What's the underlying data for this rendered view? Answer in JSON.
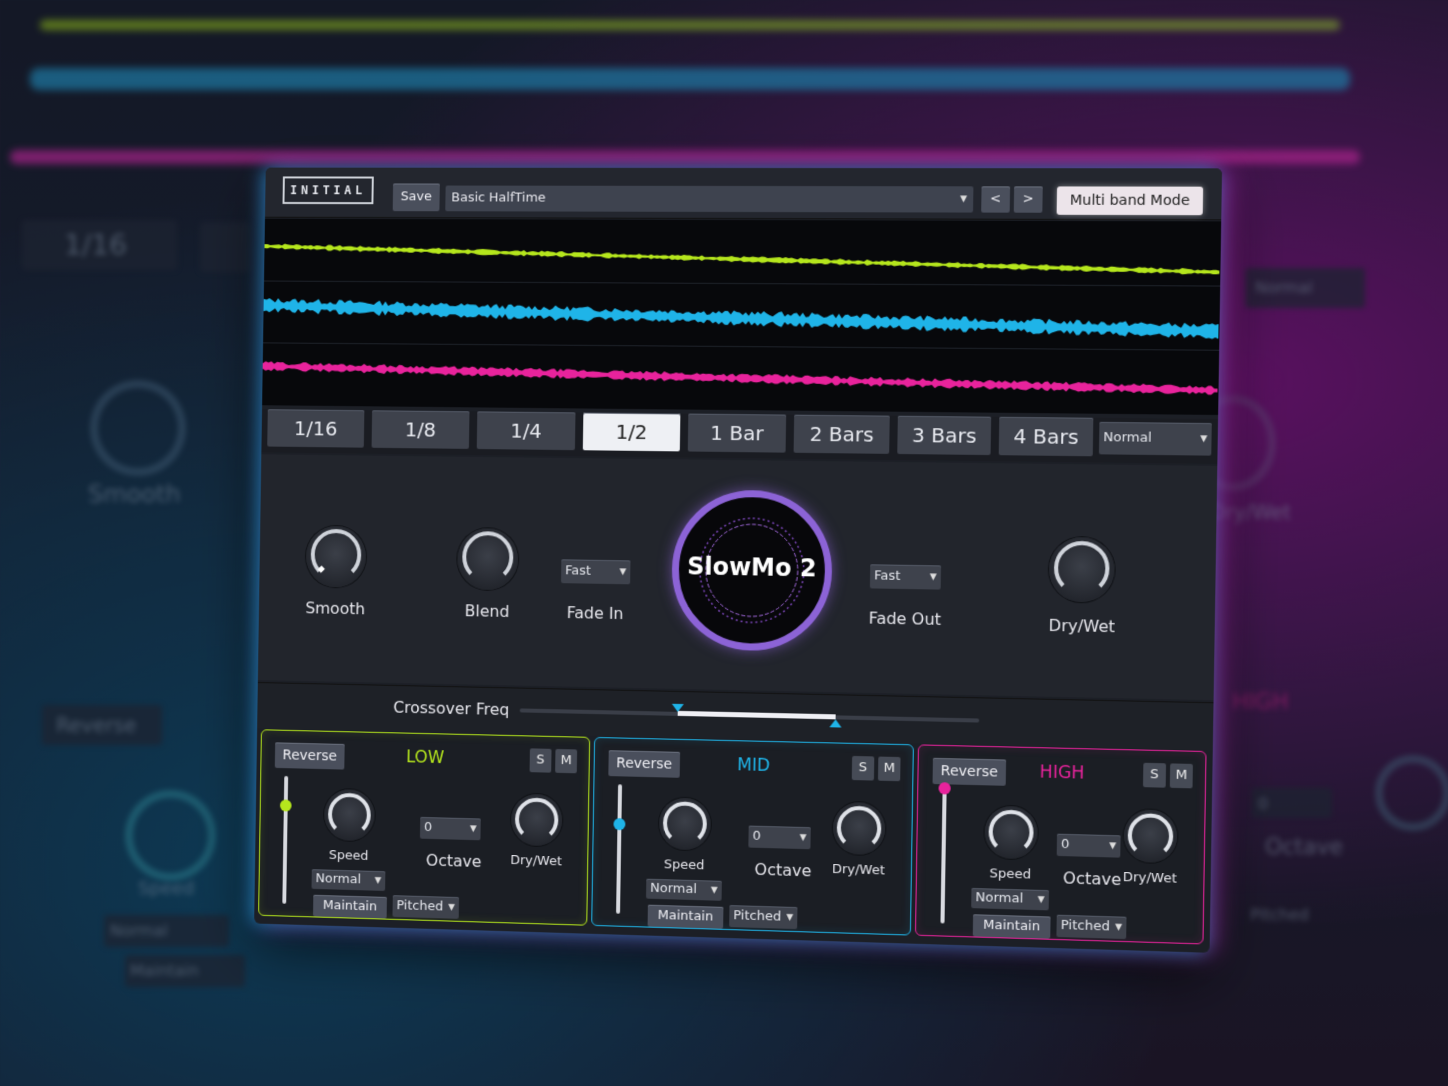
{
  "brand": {
    "logo_text": "INITIAL"
  },
  "toolbar": {
    "save_label": "Save",
    "preset_name": "Basic HalfTime",
    "prev_label": "<",
    "next_label": ">",
    "mode_button_label": "Multi band Mode"
  },
  "divisions": {
    "items": [
      "1/16",
      "1/8",
      "1/4",
      "1/2",
      "1 Bar",
      "2 Bars",
      "3 Bars",
      "4 Bars"
    ],
    "selected": "1/2",
    "mode_select_value": "Normal"
  },
  "controls": {
    "smooth_label": "Smooth",
    "blend_label": "Blend",
    "fade_in_label": "Fade In",
    "fade_in_value": "Fast",
    "fade_out_label": "Fade Out",
    "fade_out_value": "Fast",
    "dry_wet_label": "Dry/Wet",
    "product_name": "SlowMo 2"
  },
  "crossover": {
    "label": "Crossover Freq"
  },
  "bands": {
    "low": {
      "title": "LOW",
      "color": "#b5e61d",
      "reverse_label": "Reverse",
      "solo_label": "S",
      "mute_label": "M",
      "speed_label": "Speed",
      "speed_mode_value": "Normal",
      "octave_label": "Octave",
      "octave_value": "0",
      "dry_wet_label": "Dry/Wet",
      "maintain_label": "Maintain",
      "pitch_mode_value": "Pitched"
    },
    "mid": {
      "title": "MID",
      "color": "#1fb4e8",
      "reverse_label": "Reverse",
      "solo_label": "S",
      "mute_label": "M",
      "speed_label": "Speed",
      "speed_mode_value": "Normal",
      "octave_label": "Octave",
      "octave_value": "0",
      "dry_wet_label": "Dry/Wet",
      "maintain_label": "Maintain",
      "pitch_mode_value": "Pitched"
    },
    "high": {
      "title": "HIGH",
      "color": "#e8239c",
      "reverse_label": "Reverse",
      "solo_label": "S",
      "mute_label": "M",
      "speed_label": "Speed",
      "speed_mode_value": "Normal",
      "octave_label": "Octave",
      "octave_value": "0",
      "dry_wet_label": "Dry/Wet",
      "maintain_label": "Maintain",
      "pitch_mode_value": "Pitched"
    }
  },
  "background": {
    "division_label": "1/16",
    "smooth_label": "Smooth",
    "reverse_label": "Reverse",
    "speed_label": "Speed",
    "normal_label": "Normal",
    "maintain_label": "Maintain",
    "high_label": "HIGH",
    "octave_label": "Octave",
    "octave_value": "0",
    "dry_wet_label": "Dry/Wet",
    "pitched_label": "Pitched",
    "normal_select_label": "Normal"
  },
  "icons": {
    "dropdown": "chevron-down-icon",
    "prev": "chevron-left-icon",
    "next": "chevron-right-icon"
  }
}
